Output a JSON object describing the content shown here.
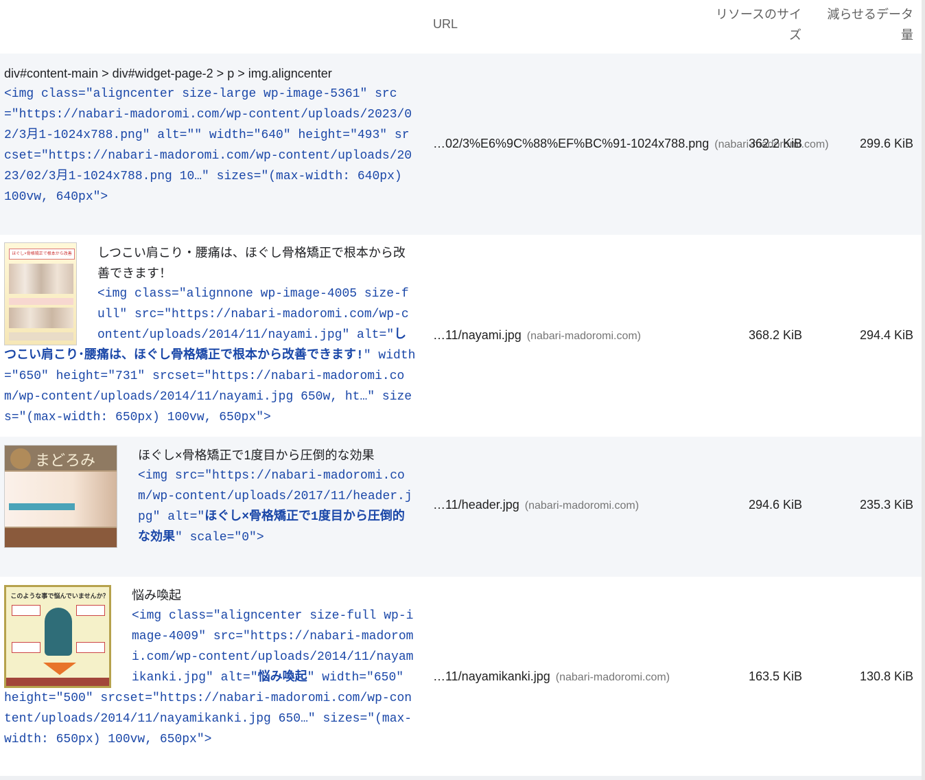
{
  "header": {
    "url_label": "URL",
    "resource_size_label": "リソースのサイズ",
    "savings_label": "減らせるデータ量"
  },
  "rows": [
    {
      "selector": "div#content-main > div#widget-page-2 > p > img.aligncenter",
      "code": "<img class=\"aligncenter size-large wp-image-5361\" src=\"https://nabari-madoromi.com/wp-content/uploads/2023/02/3月1-1024x788.png\" alt=\"\" width=\"640\" height=\"493\" srcset=\"https://nabari-madoromi.com/wp-content/uploads/2023/02/3月1-1024x788.png 10…\" sizes=\"(max-width: 640px) 100vw, 640px\">",
      "url": "…02/3%E6%9C%88%EF%BC%91-1024x788.png",
      "host": "(nabari-madoromi.com)",
      "size": "362.2 KiB",
      "savings": "299.6 KiB"
    },
    {
      "label": "しつこい肩こり・腰痛は、ほぐし骨格矯正で根本から改善できます！",
      "code_pre": "<img class=\"alignnone wp-image-4005 size-full\" src=\"https://nabari-madoromi.com/wp-content/uploads/2014/11/nayami.jpg\" alt=\"",
      "code_bold": "しつこい肩こり･腰痛は、ほぐし骨格矯正で根本から改善できます!",
      "code_post": "\" width=\"650\" height=\"731\" srcset=\"https://nabari-madoromi.com/wp-content/uploads/2014/11/nayami.jpg 650w, ht…\" sizes=\"(max-width: 650px) 100vw, 650px\">",
      "url": "…11/nayami.jpg",
      "host": "(nabari-madoromi.com)",
      "size": "368.2 KiB",
      "savings": "294.4 KiB"
    },
    {
      "label": "ほぐし×骨格矯正で1度目から圧倒的な効果",
      "code_pre": "<img src=\"https://nabari-madoromi.com/wp-content/uploads/2017/11/header.jpg\" alt=\"",
      "code_bold": "ほぐし×骨格矯正で1度目から圧倒的な効果",
      "code_post": "\" scale=\"0\">",
      "url": "…11/header.jpg",
      "host": "(nabari-madoromi.com)",
      "size": "294.6 KiB",
      "savings": "235.3 KiB"
    },
    {
      "label": "悩み喚起",
      "code_pre": "<img class=\"aligncenter size-full wp-image-4009\" src=\"https://nabari-madoromi.com/wp-content/uploads/2014/11/nayamikanki.jpg\" alt=\"",
      "code_bold": "悩み喚起",
      "code_post": "\" width=\"650\" height=\"500\" srcset=\"https://nabari-madoromi.com/wp-content/uploads/2014/11/nayamikanki.jpg 650…\" sizes=\"(max-width: 650px) 100vw, 650px\">",
      "url": "…11/nayamikanki.jpg",
      "host": "(nabari-madoromi.com)",
      "size": "163.5 KiB",
      "savings": "130.8 KiB"
    }
  ],
  "thumbnails": {
    "row2_heading": "ほぐし×骨格矯正で根本から改善",
    "row3_heading": "まどろみ",
    "row4_heading": "このような事で悩んでいませんか？"
  },
  "colors": {
    "code_text": "#1a47a8",
    "row_alt_bg": "#f4f6f9"
  }
}
